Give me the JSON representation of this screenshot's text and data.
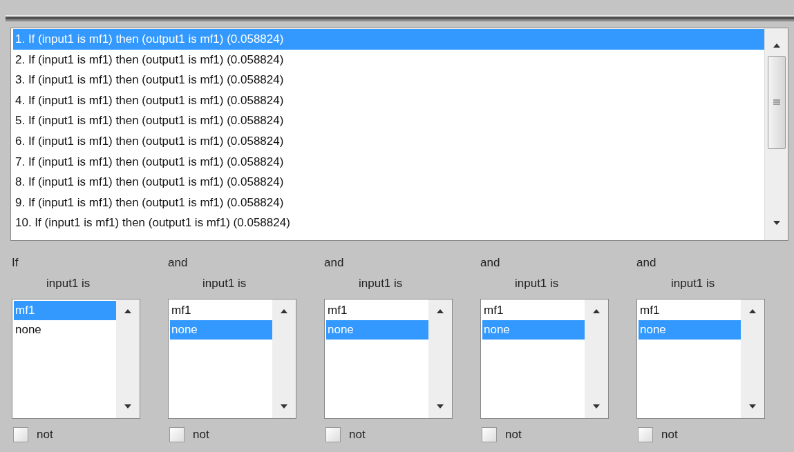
{
  "rules": [
    {
      "text": "1. If (input1 is mf1) then (output1 is mf1) (0.058824)",
      "selected": true
    },
    {
      "text": "2. If (input1 is mf1) then (output1 is mf1) (0.058824)",
      "selected": false
    },
    {
      "text": "3. If (input1 is mf1) then (output1 is mf1) (0.058824)",
      "selected": false
    },
    {
      "text": "4. If (input1 is mf1) then (output1 is mf1) (0.058824)",
      "selected": false
    },
    {
      "text": "5. If (input1 is mf1) then (output1 is mf1) (0.058824)",
      "selected": false
    },
    {
      "text": "6. If (input1 is mf1) then (output1 is mf1) (0.058824)",
      "selected": false
    },
    {
      "text": "7. If (input1 is mf1) then (output1 is mf1) (0.058824)",
      "selected": false
    },
    {
      "text": "8. If (input1 is mf1) then (output1 is mf1) (0.058824)",
      "selected": false
    },
    {
      "text": "9. If (input1 is mf1) then (output1 is mf1) (0.058824)",
      "selected": false
    },
    {
      "text": "10. If (input1 is mf1) then (output1 is mf1) (0.058824)",
      "selected": false
    }
  ],
  "conditions": [
    {
      "connector": "If",
      "label": "input1 is",
      "options": [
        {
          "text": "mf1",
          "selected": true
        },
        {
          "text": "none",
          "selected": false
        }
      ],
      "not": {
        "label": "not",
        "checked": false
      }
    },
    {
      "connector": "and",
      "label": "input1 is",
      "options": [
        {
          "text": "mf1",
          "selected": false
        },
        {
          "text": "none",
          "selected": true
        }
      ],
      "not": {
        "label": "not",
        "checked": false
      }
    },
    {
      "connector": "and",
      "label": "input1 is",
      "options": [
        {
          "text": "mf1",
          "selected": false
        },
        {
          "text": "none",
          "selected": true
        }
      ],
      "not": {
        "label": "not",
        "checked": false
      }
    },
    {
      "connector": "and",
      "label": "input1 is",
      "options": [
        {
          "text": "mf1",
          "selected": false
        },
        {
          "text": "none",
          "selected": true
        }
      ],
      "not": {
        "label": "not",
        "checked": false
      }
    },
    {
      "connector": "and",
      "label": "input1 is",
      "options": [
        {
          "text": "mf1",
          "selected": false
        },
        {
          "text": "none",
          "selected": true
        }
      ],
      "not": {
        "label": "not",
        "checked": false
      }
    }
  ]
}
